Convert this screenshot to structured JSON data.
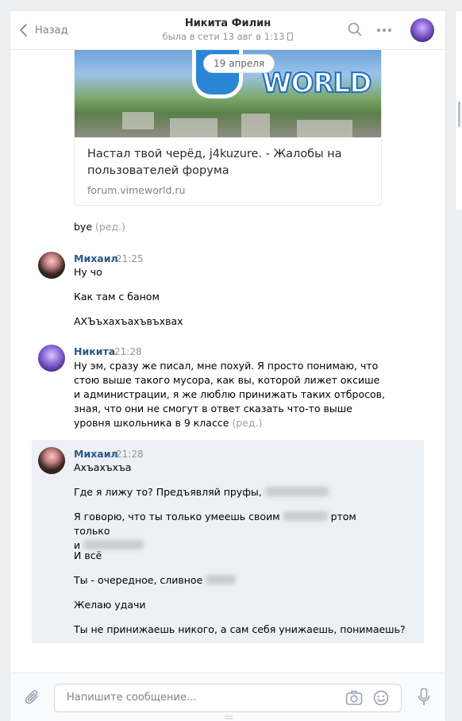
{
  "header": {
    "back_label": "Назад",
    "contact_name": "Никита Филин",
    "status": "была в сети 13 авг в 1:13",
    "icons": [
      "chevron-left-icon",
      "phone-icon",
      "search-icon",
      "more-icon"
    ]
  },
  "date_divider": "19 апреля",
  "link_card": {
    "logo_text": "WORLD",
    "title": "Настал твой черёд, j4kuzure. - Жалобы на пользователей форума",
    "url": "forum.vimeworld.ru"
  },
  "messages": [
    {
      "text": "bye",
      "edited": "(ред.)"
    },
    {
      "author": "Михаил",
      "time": "21:25",
      "lines": [
        "Ну чо",
        "Как там с баном",
        "АХЪъхахъахъвъхвах"
      ]
    },
    {
      "author": "Никита",
      "time": "21:28",
      "text": "Ну эм, сразу же писал, мне похуй. Я просто понимаю, что стою выше такого мусора, как вы, которой лижет оксише и администрации, я же люблю принижать таких отбросов, зная, что они не смогут в ответ сказать что-то выше уровня школьника в 9 классе",
      "edited": "(ред.)"
    },
    {
      "author": "Михаил",
      "time": "21:28",
      "lines": [
        "Ахъахъхъа",
        "Где я лижу то? Предъявляй пруфы,",
        "Я говорю, что ты только умеешь своим",
        "ртом только",
        "и",
        "И всё",
        "Ты - очередное, сливное",
        "Желаю удачи",
        "Ты не принижаешь никого, а сам себя унижаешь, понимаешь?"
      ]
    }
  ],
  "composer": {
    "placeholder": "Напишите сообщение...",
    "icons": [
      "paperclip-icon",
      "camera-icon",
      "smile-icon",
      "microphone-icon"
    ]
  },
  "colors": {
    "author_link": "#2a5885",
    "page_bg": "#edeef0",
    "highlight_bg": "#edf0f5"
  }
}
